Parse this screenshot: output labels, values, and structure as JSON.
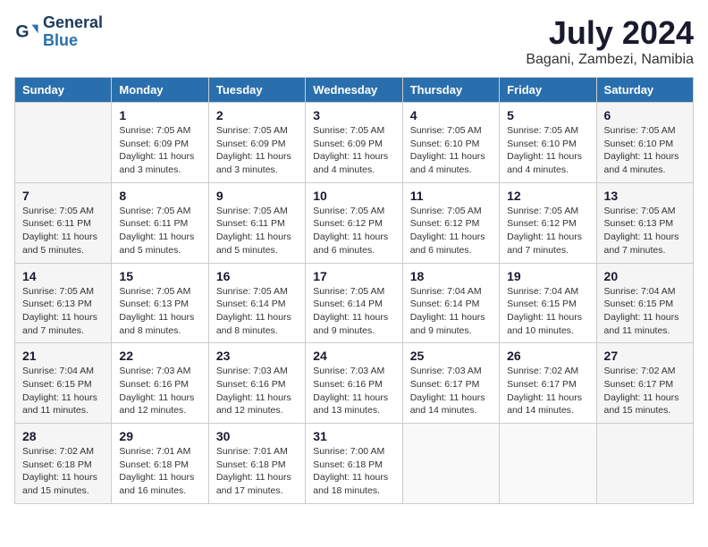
{
  "logo": {
    "line1": "General",
    "line2": "Blue"
  },
  "title": "July 2024",
  "subtitle": "Bagani, Zambezi, Namibia",
  "weekdays": [
    "Sunday",
    "Monday",
    "Tuesday",
    "Wednesday",
    "Thursday",
    "Friday",
    "Saturday"
  ],
  "weeks": [
    [
      {
        "day": "",
        "info": ""
      },
      {
        "day": "1",
        "info": "Sunrise: 7:05 AM\nSunset: 6:09 PM\nDaylight: 11 hours\nand 3 minutes."
      },
      {
        "day": "2",
        "info": "Sunrise: 7:05 AM\nSunset: 6:09 PM\nDaylight: 11 hours\nand 3 minutes."
      },
      {
        "day": "3",
        "info": "Sunrise: 7:05 AM\nSunset: 6:09 PM\nDaylight: 11 hours\nand 4 minutes."
      },
      {
        "day": "4",
        "info": "Sunrise: 7:05 AM\nSunset: 6:10 PM\nDaylight: 11 hours\nand 4 minutes."
      },
      {
        "day": "5",
        "info": "Sunrise: 7:05 AM\nSunset: 6:10 PM\nDaylight: 11 hours\nand 4 minutes."
      },
      {
        "day": "6",
        "info": "Sunrise: 7:05 AM\nSunset: 6:10 PM\nDaylight: 11 hours\nand 4 minutes."
      }
    ],
    [
      {
        "day": "7",
        "info": "Sunrise: 7:05 AM\nSunset: 6:11 PM\nDaylight: 11 hours\nand 5 minutes."
      },
      {
        "day": "8",
        "info": "Sunrise: 7:05 AM\nSunset: 6:11 PM\nDaylight: 11 hours\nand 5 minutes."
      },
      {
        "day": "9",
        "info": "Sunrise: 7:05 AM\nSunset: 6:11 PM\nDaylight: 11 hours\nand 5 minutes."
      },
      {
        "day": "10",
        "info": "Sunrise: 7:05 AM\nSunset: 6:12 PM\nDaylight: 11 hours\nand 6 minutes."
      },
      {
        "day": "11",
        "info": "Sunrise: 7:05 AM\nSunset: 6:12 PM\nDaylight: 11 hours\nand 6 minutes."
      },
      {
        "day": "12",
        "info": "Sunrise: 7:05 AM\nSunset: 6:12 PM\nDaylight: 11 hours\nand 7 minutes."
      },
      {
        "day": "13",
        "info": "Sunrise: 7:05 AM\nSunset: 6:13 PM\nDaylight: 11 hours\nand 7 minutes."
      }
    ],
    [
      {
        "day": "14",
        "info": "Sunrise: 7:05 AM\nSunset: 6:13 PM\nDaylight: 11 hours\nand 7 minutes."
      },
      {
        "day": "15",
        "info": "Sunrise: 7:05 AM\nSunset: 6:13 PM\nDaylight: 11 hours\nand 8 minutes."
      },
      {
        "day": "16",
        "info": "Sunrise: 7:05 AM\nSunset: 6:14 PM\nDaylight: 11 hours\nand 8 minutes."
      },
      {
        "day": "17",
        "info": "Sunrise: 7:05 AM\nSunset: 6:14 PM\nDaylight: 11 hours\nand 9 minutes."
      },
      {
        "day": "18",
        "info": "Sunrise: 7:04 AM\nSunset: 6:14 PM\nDaylight: 11 hours\nand 9 minutes."
      },
      {
        "day": "19",
        "info": "Sunrise: 7:04 AM\nSunset: 6:15 PM\nDaylight: 11 hours\nand 10 minutes."
      },
      {
        "day": "20",
        "info": "Sunrise: 7:04 AM\nSunset: 6:15 PM\nDaylight: 11 hours\nand 11 minutes."
      }
    ],
    [
      {
        "day": "21",
        "info": "Sunrise: 7:04 AM\nSunset: 6:15 PM\nDaylight: 11 hours\nand 11 minutes."
      },
      {
        "day": "22",
        "info": "Sunrise: 7:03 AM\nSunset: 6:16 PM\nDaylight: 11 hours\nand 12 minutes."
      },
      {
        "day": "23",
        "info": "Sunrise: 7:03 AM\nSunset: 6:16 PM\nDaylight: 11 hours\nand 12 minutes."
      },
      {
        "day": "24",
        "info": "Sunrise: 7:03 AM\nSunset: 6:16 PM\nDaylight: 11 hours\nand 13 minutes."
      },
      {
        "day": "25",
        "info": "Sunrise: 7:03 AM\nSunset: 6:17 PM\nDaylight: 11 hours\nand 14 minutes."
      },
      {
        "day": "26",
        "info": "Sunrise: 7:02 AM\nSunset: 6:17 PM\nDaylight: 11 hours\nand 14 minutes."
      },
      {
        "day": "27",
        "info": "Sunrise: 7:02 AM\nSunset: 6:17 PM\nDaylight: 11 hours\nand 15 minutes."
      }
    ],
    [
      {
        "day": "28",
        "info": "Sunrise: 7:02 AM\nSunset: 6:18 PM\nDaylight: 11 hours\nand 15 minutes."
      },
      {
        "day": "29",
        "info": "Sunrise: 7:01 AM\nSunset: 6:18 PM\nDaylight: 11 hours\nand 16 minutes."
      },
      {
        "day": "30",
        "info": "Sunrise: 7:01 AM\nSunset: 6:18 PM\nDaylight: 11 hours\nand 17 minutes."
      },
      {
        "day": "31",
        "info": "Sunrise: 7:00 AM\nSunset: 6:18 PM\nDaylight: 11 hours\nand 18 minutes."
      },
      {
        "day": "",
        "info": ""
      },
      {
        "day": "",
        "info": ""
      },
      {
        "day": "",
        "info": ""
      }
    ]
  ]
}
